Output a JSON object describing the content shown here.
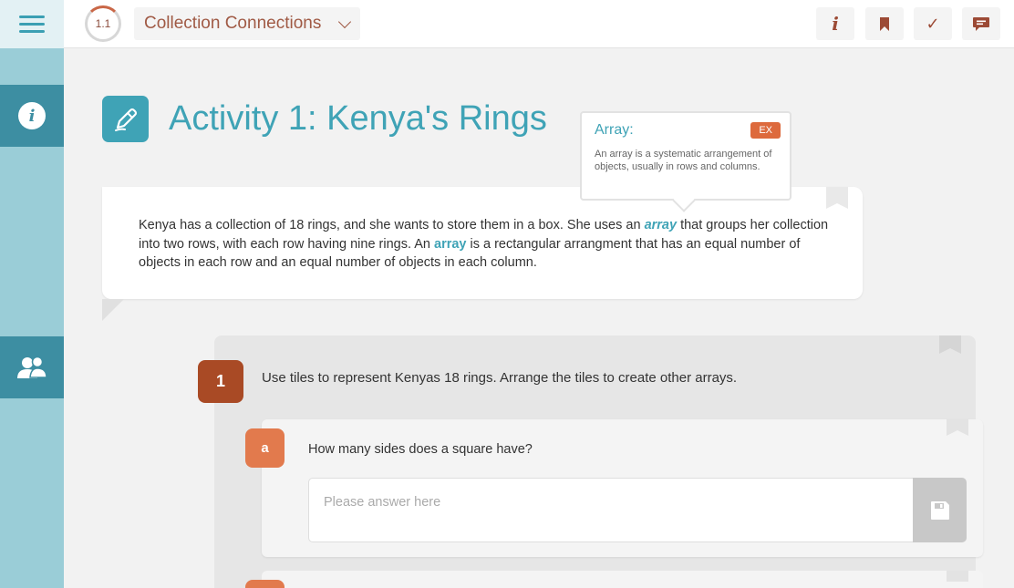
{
  "header": {
    "progress_label": "1.1",
    "collection_title": "Collection Connections",
    "tools": [
      {
        "name": "info-button",
        "icon": "info-icon",
        "glyph": "i"
      },
      {
        "name": "bookmark-button",
        "icon": "bookmark-icon"
      },
      {
        "name": "check-button",
        "icon": "checkmark-icon",
        "glyph": "✓"
      },
      {
        "name": "comments-button",
        "icon": "chat-icon"
      }
    ]
  },
  "sidebar": {
    "tabs": [
      {
        "name": "info-tab",
        "icon": "info-icon",
        "glyph": "i"
      },
      {
        "name": "group-tab",
        "icon": "people-icon"
      }
    ]
  },
  "activity": {
    "icon": "pencil-icon",
    "title": "Activity 1: Kenya's Rings"
  },
  "glossary_tooltip": {
    "term": "Array:",
    "badge": "EX",
    "definition": "An array is a systematic arrangement of objects, usually in rows and columns."
  },
  "intro": {
    "text_part1": "Kenya has a collection of 18 rings, and she wants to store them in a box. She uses an ",
    "term1": "array",
    "text_part2": " that groups her collection into two rows, with each row having nine rings. An ",
    "term2": "array",
    "text_part3": " is a rectangular arrangment that has an equal number of objects in each row and an equal number of objects in each column."
  },
  "question": {
    "number": "1",
    "text": "Use tiles to represent Kenyas 18 rings. Arrange the tiles to create other arrays.",
    "sub_questions": [
      {
        "letter": "a",
        "text": "How many sides does a square have?",
        "answer_value": "",
        "answer_placeholder": "Please answer here",
        "save_icon": "floppy-disk-icon"
      }
    ]
  },
  "colors": {
    "accent_teal": "#3fa3b6",
    "sidebar_bg": "#9acdd7",
    "sidebar_tab": "#3d8ea2",
    "brand_rust": "#a94a25",
    "sub_orange": "#e27a4d",
    "badge_orange": "#dd6a3d"
  }
}
